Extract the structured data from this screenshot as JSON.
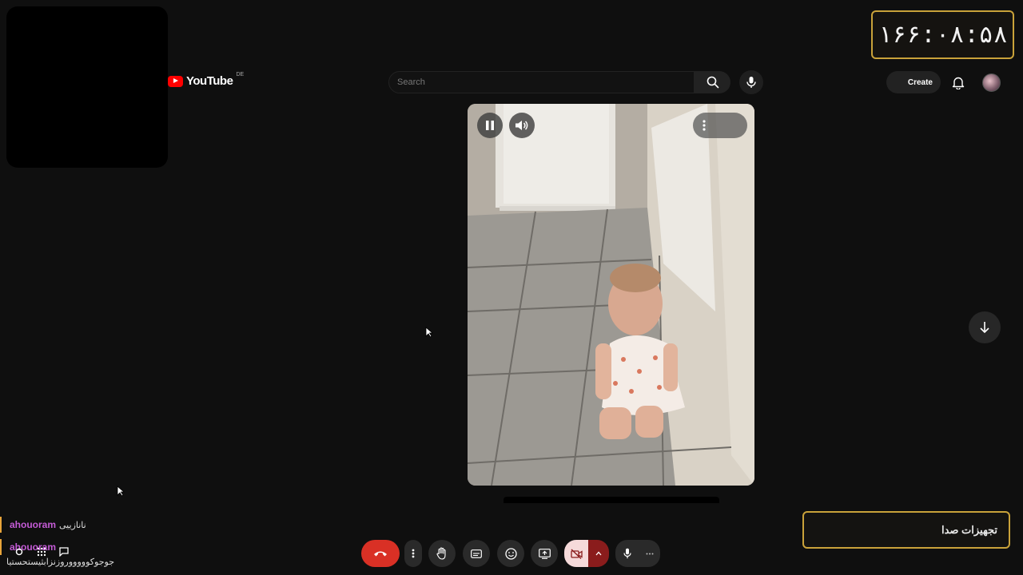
{
  "clock": {
    "value": "۱۶۶:۰۸:۵۸"
  },
  "youtube": {
    "logo_text": "YouTube",
    "region": "DE",
    "search_placeholder": "Search",
    "create_label": "Create"
  },
  "chat": {
    "messages": [
      {
        "user": "ahouoram",
        "text": "نانازییی"
      },
      {
        "user": "ahouoram",
        "text": "جوجوکوووووروزنزابثیستحستیا"
      }
    ]
  },
  "audio_panel": {
    "label": "تجهیزات صدا"
  },
  "colors": {
    "accent_gold": "#c9a23a",
    "end_call_red": "#d93025",
    "youtube_red": "#ff0000",
    "chat_username": "#c45bd6"
  },
  "icons": [
    "search-icon",
    "mic-icon",
    "bell-icon",
    "pause-icon",
    "volume-icon",
    "more-icon",
    "arrow-down-icon",
    "end-call-icon",
    "raise-hand-icon",
    "captions-icon",
    "emoji-icon",
    "present-icon",
    "camera-off-icon",
    "caret-up-icon"
  ]
}
